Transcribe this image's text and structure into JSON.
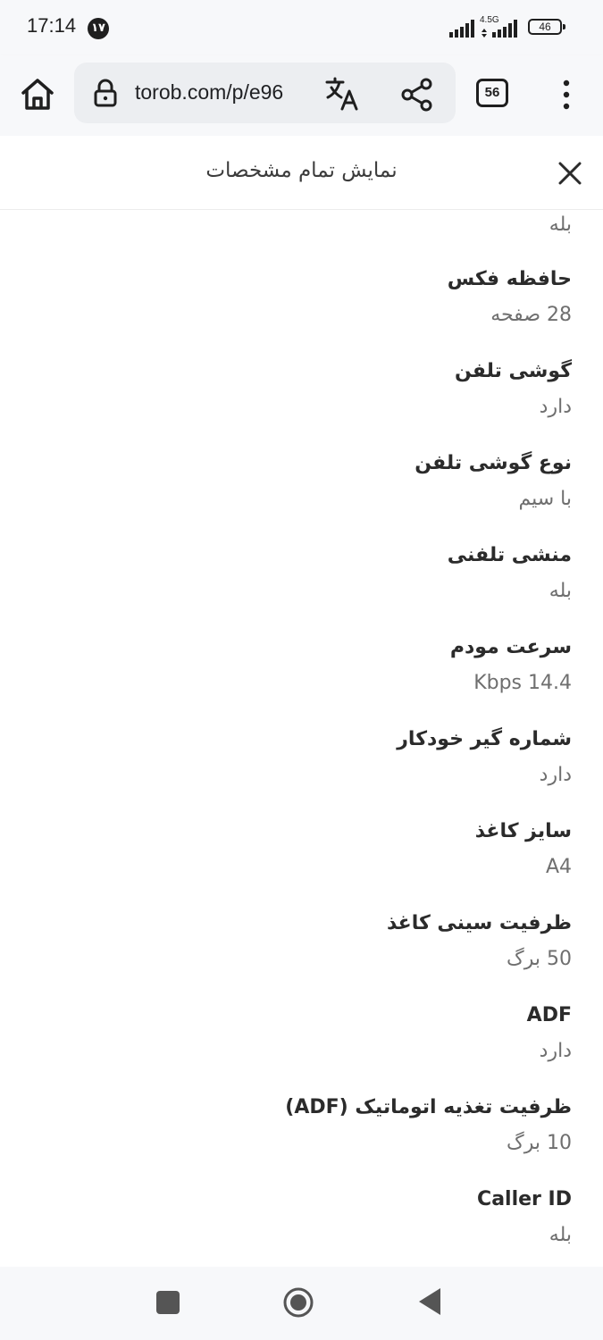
{
  "status_bar": {
    "time": "17:14",
    "notification_badge": "۱۷",
    "network_label": "4.5G",
    "battery": "46"
  },
  "browser": {
    "url": "torob.com/p/e96",
    "tab_count": "56"
  },
  "dialog": {
    "title": "نمایش تمام مشخصات"
  },
  "specs": {
    "top_value": "بله",
    "items": [
      {
        "label": "حافظه فکس",
        "value": "28 صفحه"
      },
      {
        "label": "گوشی تلفن",
        "value": "دارد"
      },
      {
        "label": "نوع گوشی تلفن",
        "value": "با سیم"
      },
      {
        "label": "منشی تلفنی",
        "value": "بله"
      },
      {
        "label": "سرعت مودم",
        "value": "Kbps 14.4"
      },
      {
        "label": "شماره گیر خودکار",
        "value": "دارد"
      },
      {
        "label": "سایز کاغذ",
        "value": "A4"
      },
      {
        "label": "ظرفیت سینی کاغذ",
        "value": "50 برگ"
      },
      {
        "label": "ADF",
        "value": "دارد"
      },
      {
        "label": "ظرفیت تغذیه اتوماتیک (ADF)",
        "value": "10 برگ"
      },
      {
        "label": "Caller ID",
        "value": "بله"
      }
    ]
  },
  "colors": {
    "bar_background": "#f7f8fa",
    "omnibox_background": "#eceef1",
    "label_text": "#2b2b2b",
    "value_text": "#6f6f6f"
  }
}
